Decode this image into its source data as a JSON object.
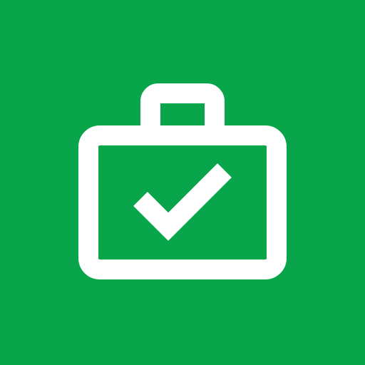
{
  "icon": {
    "name": "briefcase-check-icon",
    "background_color": "#08A54B",
    "foreground_color": "#FFFFFF"
  }
}
